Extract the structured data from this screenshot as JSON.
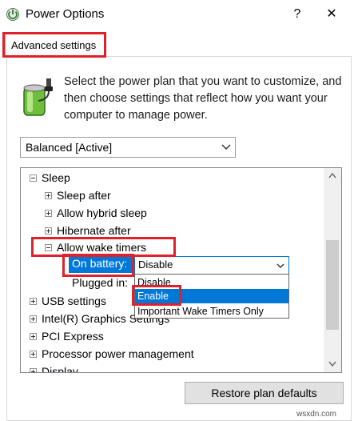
{
  "window": {
    "title": "Power Options",
    "help_symbol": "?",
    "close_symbol": "✕"
  },
  "tabs": [
    {
      "label": "Advanced settings",
      "selected": true
    }
  ],
  "description": "Select the power plan that you want to customize, and then choose settings that reflect how you want your computer to manage power.",
  "plan_select": {
    "value": "Balanced [Active]"
  },
  "tree": {
    "items": [
      {
        "label": "Sleep",
        "expander": "minus",
        "level": 0
      },
      {
        "label": "Sleep after",
        "expander": "plus",
        "level": 1
      },
      {
        "label": "Allow hybrid sleep",
        "expander": "plus",
        "level": 1
      },
      {
        "label": "Hibernate after",
        "expander": "plus",
        "level": 1
      },
      {
        "label": "Allow wake timers",
        "expander": "minus",
        "level": 1
      },
      {
        "label": "On battery:",
        "level": 2
      },
      {
        "label": "Plugged in:",
        "level": 2
      },
      {
        "label": "USB settings",
        "expander": "plus",
        "level": 0
      },
      {
        "label": "Intel(R) Graphics Settings",
        "expander": "plus",
        "level": 0
      },
      {
        "label": "PCI Express",
        "expander": "plus",
        "level": 0
      },
      {
        "label": "Processor power management",
        "expander": "plus",
        "level": 0
      },
      {
        "label": "Display",
        "expander": "plus",
        "level": 0
      }
    ],
    "on_battery_value": "Disable",
    "dropdown_options": [
      "Disable",
      "Enable",
      "Important Wake Timers Only"
    ],
    "dropdown_selected_index": 1
  },
  "buttons": {
    "restore_label": "Restore plan defaults"
  },
  "watermark": "wsxdn.com",
  "colors": {
    "accent": "#0078d7",
    "annotation_red": "#e0202a"
  }
}
